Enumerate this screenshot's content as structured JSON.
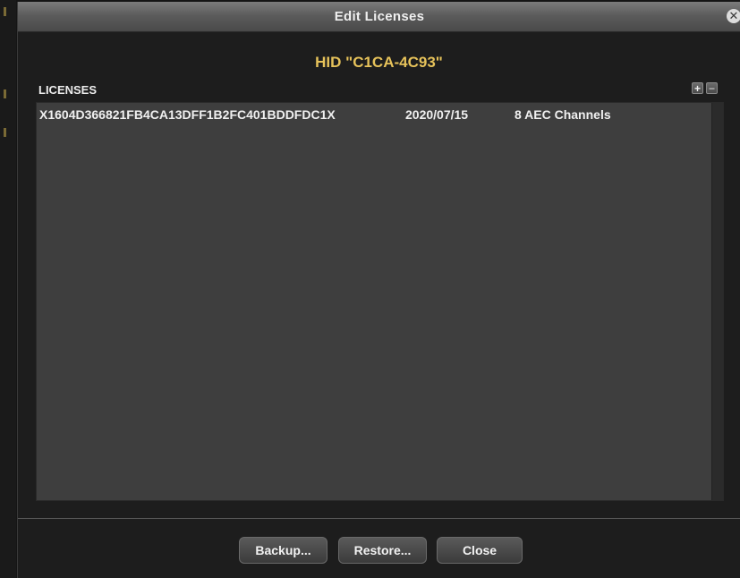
{
  "dialog": {
    "title": "Edit Licenses",
    "close_icon": "close-circle-x",
    "hid": "HID \"C1CA-4C93\""
  },
  "licenses": {
    "section_label": "LICENSES",
    "add_label": "+",
    "remove_label": "−",
    "rows": [
      {
        "key": "X1604D366821FB4CA13DFF1B2FC401BDDFDC1X",
        "date": "2020/07/15",
        "description": "8 AEC Channels"
      }
    ]
  },
  "buttons": {
    "backup": "Backup...",
    "restore": "Restore...",
    "close": "Close"
  },
  "colors": {
    "accent_gold": "#e6c25a",
    "panel": "#3e3e3e",
    "background": "#1d1d1d"
  }
}
